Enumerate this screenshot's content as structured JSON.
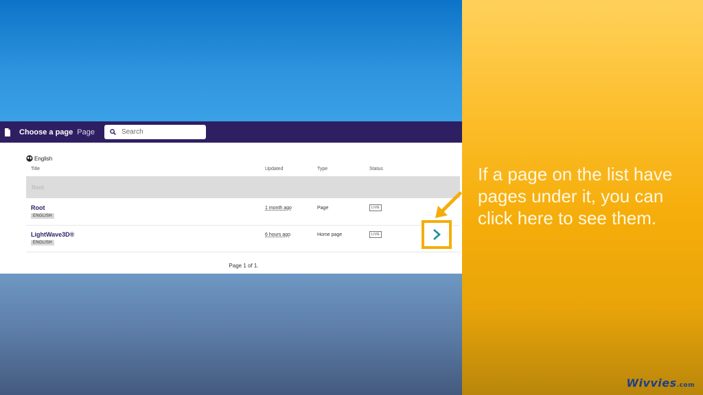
{
  "header": {
    "title": "Choose a page",
    "subtitle": "Page",
    "search_placeholder": "Search"
  },
  "locale": "English",
  "columns": {
    "title": "Title",
    "updated": "Updated",
    "type": "Type",
    "status": "Status"
  },
  "root_band": "Root",
  "rows": [
    {
      "name": "Root",
      "lang": "ENGLISH",
      "updated": "1 month ago",
      "type": "Page",
      "status": "LIVE"
    },
    {
      "name": "LightWave3D®",
      "lang": "ENGLISH",
      "updated": "6 hours ago",
      "type": "Home page",
      "status": "LIVE"
    }
  ],
  "pager": "Page 1 of 1.",
  "caption": "If a page on the list have pages under it, you can click here to see them.",
  "brand": {
    "name": "Wivvies",
    "suffix": ".com"
  },
  "icons": {
    "doc": "document-icon",
    "search": "search-icon",
    "globe": "globe-icon",
    "next": "chevron-right-icon",
    "callout": "arrow-callout-icon"
  },
  "colors": {
    "header": "#2e1f63",
    "accent": "#f5ad0a",
    "chevron": "#1a8ca0"
  }
}
